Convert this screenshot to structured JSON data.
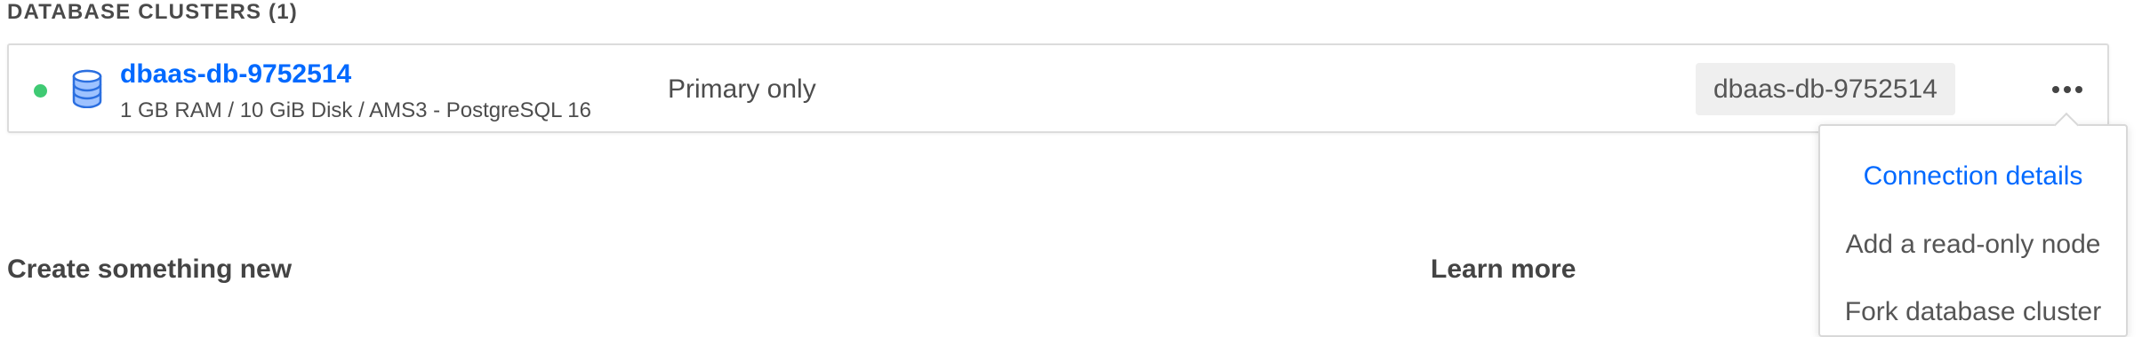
{
  "section": {
    "heading": "DATABASE CLUSTERS (1)"
  },
  "cluster": {
    "name": "dbaas-db-9752514",
    "meta": "1 GB RAM / 10 GiB Disk / AMS3 - PostgreSQL 16",
    "role": "Primary only",
    "tag": "dbaas-db-9752514",
    "status_color": "#3fca73",
    "more_icon": "more-horizontal-icon"
  },
  "menu": {
    "items": [
      {
        "label": "Connection details"
      },
      {
        "label": "Add a read-only node"
      },
      {
        "label": "Fork database cluster"
      }
    ]
  },
  "bottom": {
    "create_heading": "Create something new",
    "learn_heading": "Learn more"
  },
  "colors": {
    "accent": "#0069ff",
    "status_online": "#3fca73"
  }
}
